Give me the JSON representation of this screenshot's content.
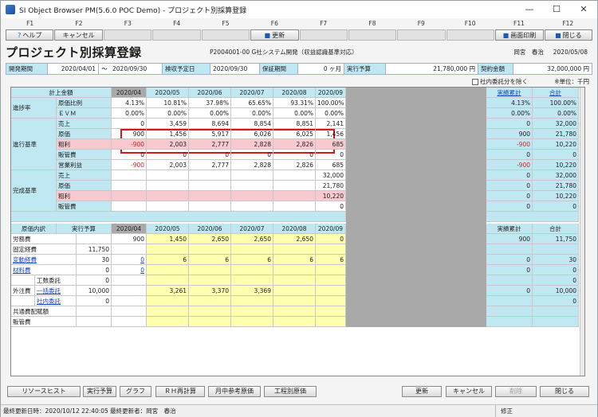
{
  "window": {
    "title": "SI Object Browser PM(5.6.0 POC Demo) - プロジェクト別採算登録",
    "minimize": "—",
    "maximize": "☐",
    "close": "✕"
  },
  "fkeys": [
    "F1",
    "F2",
    "F3",
    "F4",
    "F5",
    "F6",
    "F7",
    "F8",
    "F9",
    "F10",
    "F11",
    "F12"
  ],
  "toolbar": [
    {
      "label": "ヘルプ",
      "icon": "?"
    },
    {
      "label": "キャンセル",
      "icon": ""
    },
    {
      "label": "",
      "icon": ""
    },
    {
      "label": "",
      "icon": ""
    },
    {
      "label": "",
      "icon": ""
    },
    {
      "label": "更新",
      "icon": "■"
    },
    {
      "label": "",
      "icon": ""
    },
    {
      "label": "",
      "icon": ""
    },
    {
      "label": "",
      "icon": ""
    },
    {
      "label": "",
      "icon": ""
    },
    {
      "label": "画面印刷",
      "icon": "■"
    },
    {
      "label": "閉じる",
      "icon": "■"
    }
  ],
  "header": {
    "title": "プロジェクト別採算登録",
    "project": "P2004001-00 G社システム開発（収益認識基準対応）",
    "user": "岡宮　春治",
    "date": "2020/05/08"
  },
  "info": {
    "period_label": "開発期間",
    "period_from": "2020/04/01",
    "period_sep": "〜",
    "period_to": "2020/09/30",
    "accept_label": "検収予定日",
    "accept_date": "2020/09/30",
    "warranty_label": "保証期間",
    "warranty_value": "0 ヶ月",
    "budget_label": "実行予算",
    "budget_value": "21,780,000 円",
    "contract_label": "契約金額",
    "contract_value": "32,000,000 円"
  },
  "options": {
    "exclude_internal": "社内委託分を除く",
    "unit": "※単位：千円"
  },
  "grid": {
    "top_header": {
      "label": "計上金額",
      "months": [
        "2020/04",
        "2020/05",
        "2020/06",
        "2020/07",
        "2020/08",
        "2020/09"
      ],
      "actual_total": "実績累計",
      "total": "合計"
    },
    "progress": {
      "group": "進捗率",
      "rows": [
        {
          "label": "原価比例",
          "values": [
            "4.13%",
            "10.81%",
            "37.98%",
            "65.65%",
            "93.31%",
            "100.00%"
          ],
          "actual": "4.13%",
          "total": "100.00%"
        },
        {
          "label": "ＥＶＭ",
          "values": [
            "0.00%",
            "0.00%",
            "0.00%",
            "0.00%",
            "0.00%",
            "0.00%"
          ],
          "actual": "0.00%",
          "total": "0.00%"
        }
      ]
    },
    "progress_basis": {
      "group": "進行基準",
      "rows": [
        {
          "label": "売上",
          "values": [
            "0",
            "3,459",
            "8,694",
            "8,854",
            "8,851",
            "2,141"
          ],
          "actual": "0",
          "total": "32,000"
        },
        {
          "label": "原価",
          "values": [
            "900",
            "1,456",
            "5,917",
            "6,026",
            "6,025",
            "1,456"
          ],
          "actual": "900",
          "total": "21,780"
        },
        {
          "label": "粗利",
          "values": [
            "-900",
            "2,003",
            "2,777",
            "2,828",
            "2,826",
            "685"
          ],
          "actual": "-900",
          "total": "10,220"
        },
        {
          "label": "販管費",
          "values": [
            "0",
            "0",
            "0",
            "0",
            "0",
            "0"
          ],
          "actual": "0",
          "total": "0"
        },
        {
          "label": "営業利益",
          "values": [
            "-900",
            "2,003",
            "2,777",
            "2,828",
            "2,826",
            "685"
          ],
          "actual": "-900",
          "total": "10,220"
        }
      ]
    },
    "completion_basis": {
      "group": "完成基準",
      "rows": [
        {
          "label": "売上",
          "values": [
            "",
            "",
            "",
            "",
            "",
            "32,000"
          ],
          "actual": "0",
          "total": "32,000"
        },
        {
          "label": "原価",
          "values": [
            "",
            "",
            "",
            "",
            "",
            "21,780"
          ],
          "actual": "0",
          "total": "21,780"
        },
        {
          "label": "粗利",
          "values": [
            "",
            "",
            "",
            "",
            "",
            "10,220"
          ],
          "actual": "0",
          "total": "10,220"
        },
        {
          "label": "販管費",
          "values": [
            "",
            "",
            "",
            "",
            "",
            "0"
          ],
          "actual": "0",
          "total": "0"
        }
      ]
    },
    "cost_header": {
      "label": "原価内訳",
      "budget": "実行予算",
      "months": [
        "2020/04",
        "2020/05",
        "2020/06",
        "2020/07",
        "2020/08",
        "2020/09"
      ],
      "actual_total": "実績累計",
      "total": "合計"
    },
    "cost_rows": [
      {
        "label": "労務費",
        "sub": "",
        "budget": "",
        "values": [
          "900",
          "1,450",
          "2,650",
          "2,650",
          "2,650",
          "0"
        ],
        "actual": "900",
        "total": "11,750"
      },
      {
        "label": "固定経費",
        "sub": "",
        "budget": "11,750",
        "values": [
          "",
          "",
          "",
          "",
          "",
          ""
        ],
        "actual": "",
        "total": ""
      },
      {
        "label": "変動経費",
        "sub": "",
        "budget": "30",
        "values": [
          "0",
          "6",
          "6",
          "6",
          "6",
          "6"
        ],
        "actual": "0",
        "total": "30"
      },
      {
        "label": "材料費",
        "sub": "",
        "budget": "0",
        "values": [
          "0",
          "",
          "",
          "",
          "",
          ""
        ],
        "actual": "0",
        "total": "0"
      },
      {
        "label": "",
        "sub": "工数委託",
        "budget": "0",
        "values": [
          "",
          "",
          "",
          "",
          "",
          ""
        ],
        "actual": "",
        "total": "0"
      },
      {
        "label": "外注費",
        "sub": "一括委託",
        "budget": "10,000",
        "values": [
          "",
          "3,261",
          "3,370",
          "3,369",
          "",
          ""
        ],
        "actual": "0",
        "total": "10,000"
      },
      {
        "label": "",
        "sub": "社内委託",
        "budget": "0",
        "values": [
          "",
          "",
          "",
          "",
          "",
          ""
        ],
        "actual": "",
        "total": "0"
      },
      {
        "label": "共通費配賦額",
        "sub": "",
        "budget": "",
        "values": [
          "",
          "",
          "",
          "",
          "",
          ""
        ],
        "actual": "",
        "total": ""
      },
      {
        "label": "販管費",
        "sub": "",
        "budget": "",
        "values": [
          "",
          "",
          "",
          "",
          "",
          ""
        ],
        "actual": "",
        "total": ""
      }
    ]
  },
  "bottom_buttons": [
    "リソースヒスト",
    "実行予算",
    "グラフ",
    "ＲＨ再計算",
    "月中参考原価",
    "工程別原価",
    "更新",
    "キャンセル",
    "削除",
    "閉じる"
  ],
  "status": {
    "text": "最終更新日時：2020/10/12 22:40:05  最終更新者：岡宮　春治",
    "mode": "修正"
  }
}
